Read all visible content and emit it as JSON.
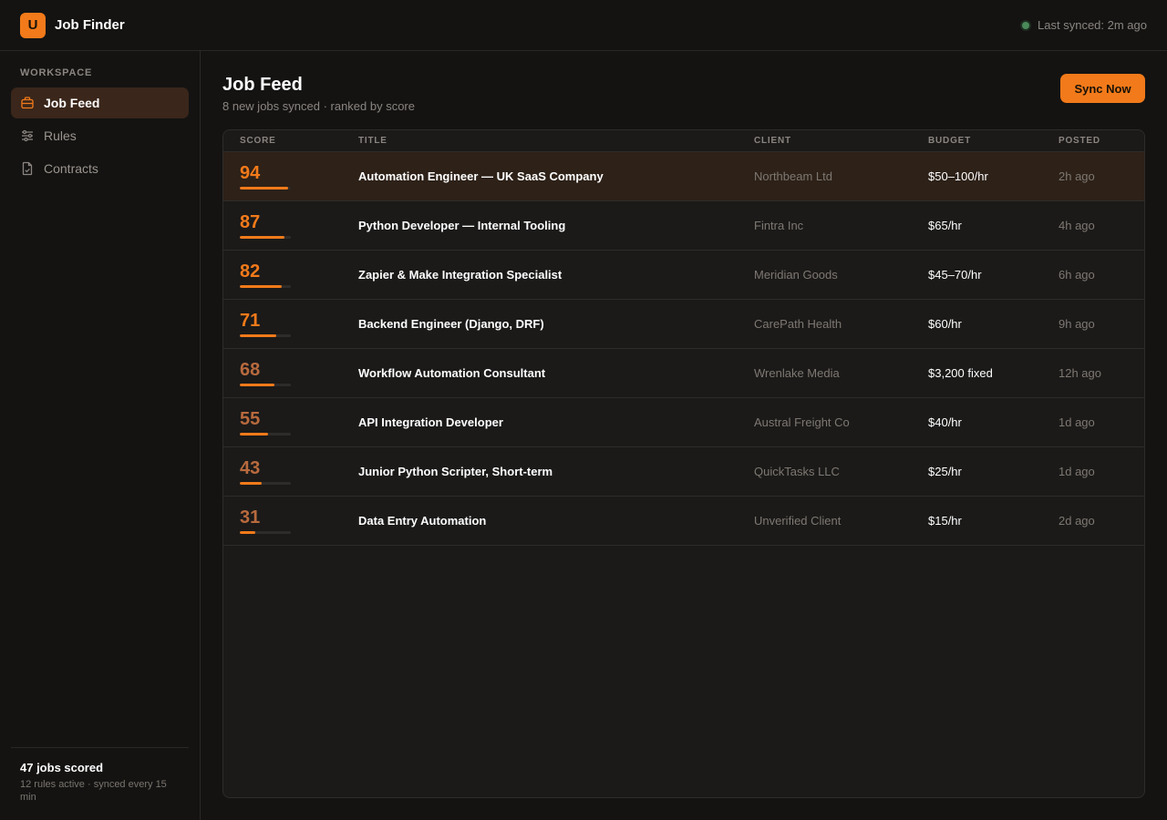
{
  "app": {
    "logo_letter": "U",
    "title": "Job Finder",
    "sync_status": "Last synced: 2m ago"
  },
  "sidebar": {
    "section_label": "WORKSPACE",
    "items": [
      {
        "label": "Job Feed",
        "icon": "briefcase-icon",
        "active": true
      },
      {
        "label": "Rules",
        "icon": "sliders-icon",
        "active": false
      },
      {
        "label": "Contracts",
        "icon": "document-check-icon",
        "active": false
      }
    ],
    "footer": {
      "count": "47 jobs scored",
      "meta": "12 rules active · synced every 15 min"
    }
  },
  "main": {
    "title": "Job Feed",
    "subtitle": "8 new jobs synced · ranked by score",
    "sync_button": "Sync Now",
    "columns": [
      "SCORE",
      "TITLE",
      "CLIENT",
      "BUDGET",
      "POSTED"
    ],
    "rows": [
      {
        "score": 94,
        "title": "Automation Engineer — UK SaaS Company",
        "client": "Northbeam Ltd",
        "budget": "$50–100/hr",
        "posted": "2h ago"
      },
      {
        "score": 87,
        "title": "Python Developer — Internal Tooling",
        "client": "Fintra Inc",
        "budget": "$65/hr",
        "posted": "4h ago"
      },
      {
        "score": 82,
        "title": "Zapier & Make Integration Specialist",
        "client": "Meridian Goods",
        "budget": "$45–70/hr",
        "posted": "6h ago"
      },
      {
        "score": 71,
        "title": "Backend Engineer (Django, DRF)",
        "client": "CarePath Health",
        "budget": "$60/hr",
        "posted": "9h ago"
      },
      {
        "score": 68,
        "title": "Workflow Automation Consultant",
        "client": "Wrenlake Media",
        "budget": "$3,200 fixed",
        "posted": "12h ago"
      },
      {
        "score": 55,
        "title": "API Integration Developer",
        "client": "Austral Freight Co",
        "budget": "$40/hr",
        "posted": "1d ago"
      },
      {
        "score": 43,
        "title": "Junior Python Scripter, Short-term",
        "client": "QuickTasks LLC",
        "budget": "$25/hr",
        "posted": "1d ago"
      },
      {
        "score": 31,
        "title": "Data Entry Automation",
        "client": "Unverified Client",
        "budget": "$15/hr",
        "posted": "2d ago"
      }
    ]
  },
  "colors": {
    "accent": "#f27a1a",
    "score_high": "#f27a1a",
    "score_low": "#b86a3e",
    "background": "#141312",
    "panel": "#1b1a19",
    "highlight_row": "#2d2118"
  }
}
